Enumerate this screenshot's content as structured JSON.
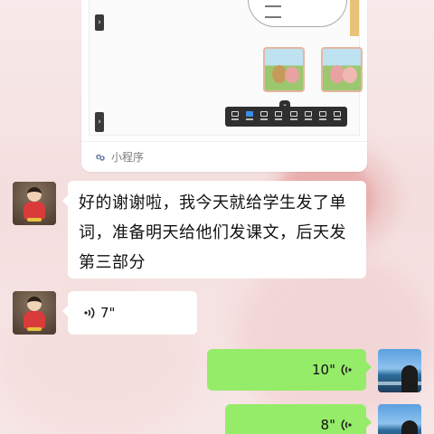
{
  "shared_card": {
    "footer_label": "小程序"
  },
  "messages": [
    {
      "side": "left",
      "type": "text",
      "text": "好的谢谢啦，我今天就给学生发了单词，准备明天给他们发课文，后天发第三部分"
    },
    {
      "side": "left",
      "type": "voice",
      "duration": "7\""
    },
    {
      "side": "right",
      "type": "voice",
      "duration": "10\""
    },
    {
      "side": "right",
      "type": "voice",
      "duration": "8\""
    }
  ],
  "colors": {
    "outgoing_bubble": "#95ec69",
    "incoming_bubble": "#ffffff",
    "toolbar": "#2f2f2f",
    "toolbar_active": "#3a8ee6"
  },
  "icons": [
    "mini-program-icon",
    "voice-incoming-icon",
    "voice-outgoing-icon"
  ]
}
